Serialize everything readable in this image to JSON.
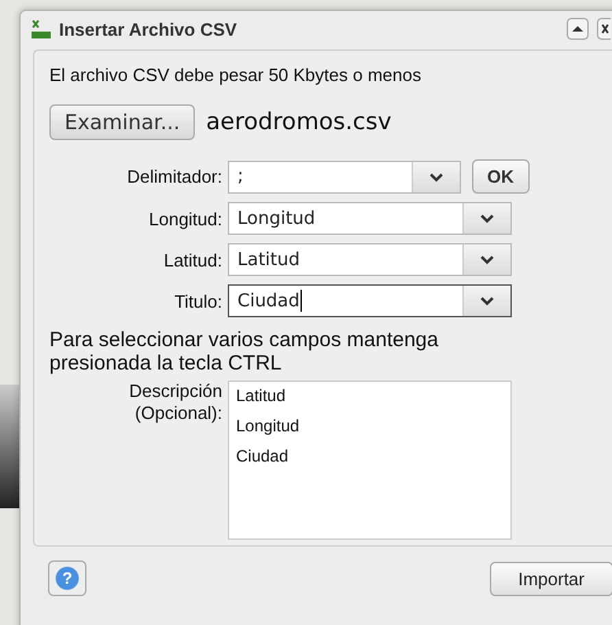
{
  "window": {
    "title": "Insertar Archivo CSV"
  },
  "notice": "El archivo CSV debe pesar 50 Kbytes o menos",
  "browse": {
    "button": "Examinar...",
    "file_name": "aerodromos.csv"
  },
  "delimiter": {
    "label": "Delimitador:",
    "value": ";",
    "ok_button": "OK"
  },
  "fields": [
    {
      "label": "Longitud:",
      "value": "Longitud",
      "focused": false
    },
    {
      "label": "Latitud:",
      "value": "Latitud",
      "focused": false
    },
    {
      "label": "Titulo:",
      "value": "Ciudad",
      "focused": true
    }
  ],
  "hint": "Para seleccionar varios campos mantenga presionada la tecla CTRL",
  "description": {
    "label_lines": [
      "Descripción",
      "(Opcional):"
    ],
    "items": [
      {
        "label": "Latitud",
        "selected": false
      },
      {
        "label": "Longitud",
        "selected": false
      },
      {
        "label": "Ciudad",
        "selected": false
      }
    ]
  },
  "help_button": {
    "label": "?"
  },
  "import_button": "Importar"
}
